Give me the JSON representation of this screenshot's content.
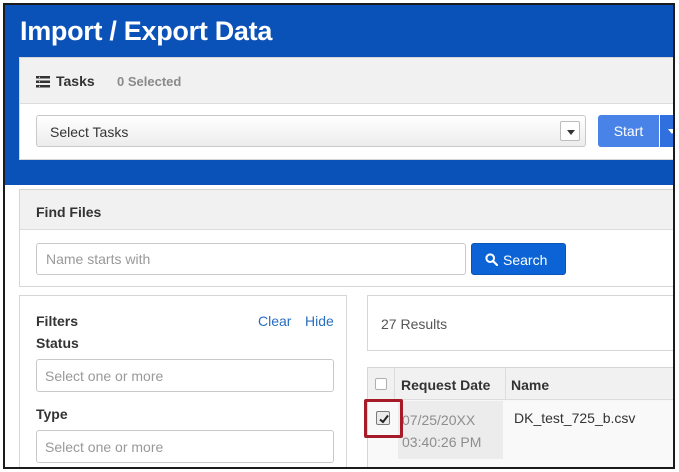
{
  "header": {
    "title": "Import / Export Data"
  },
  "tasks": {
    "label": "Tasks",
    "selected_count": "0 Selected",
    "select_value": "Select Tasks",
    "start_label": "Start"
  },
  "find_files": {
    "title": "Find Files",
    "name_placeholder": "Name starts with",
    "search_label": "Search"
  },
  "filters": {
    "title": "Filters",
    "clear_label": "Clear",
    "hide_label": "Hide",
    "status_label": "Status",
    "status_placeholder": "Select one or more",
    "type_label": "Type",
    "type_placeholder": "Select one or more"
  },
  "results": {
    "count": "27 Results",
    "columns": [
      "Request Date",
      "Name"
    ],
    "rows": [
      {
        "date_line1": "07/25/20XX",
        "date_line2": "03:40:26 PM",
        "name": "DK_test_725_b.csv",
        "checked": true
      }
    ]
  },
  "colors": {
    "header_blue": "#0b52b8",
    "primary_button": "#4a83e8",
    "search_button": "#0b63d6",
    "link": "#2a6ebf",
    "highlight": "#a51b2a"
  },
  "icons": [
    "list-icon",
    "search-icon",
    "chevron-down-icon",
    "checkbox-checked-icon"
  ]
}
